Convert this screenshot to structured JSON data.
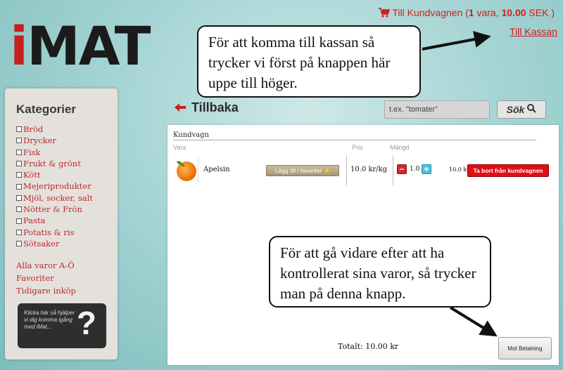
{
  "logo": {
    "i": "i",
    "mat": "MAT"
  },
  "header": {
    "cart_text_prefix": "Till Kundvagnen (",
    "cart_count": "1",
    "cart_mid": " vara, ",
    "cart_amount": "10.00",
    "cart_suffix": " SEK )",
    "checkout_link": "Till Kassan"
  },
  "callouts": {
    "top": "För att komma till kassan så trycker vi först på knappen här uppe till höger.",
    "bottom": "För att gå vidare efter att ha kontrollerat sina varor, så trycker man på denna knapp."
  },
  "sidebar": {
    "title": "Kategorier",
    "categories": [
      "Bröd",
      "Drycker",
      "Fisk",
      "Frukt & grönt",
      "Kött",
      "Mejeriprodukter",
      "Mjöl, socker, salt",
      "Nötter & Frön",
      "Pasta",
      "Potatis & ris",
      "Sötsaker"
    ],
    "links": [
      "Alla varor A-Ö",
      "Favoriter",
      "Tidigare inköp"
    ],
    "help_text": "Klicka här så hjälper vi dig komma igång med iMat...",
    "help_symbol": "?"
  },
  "toolbar": {
    "back_label": "Tillbaka",
    "search_placeholder": "t.ex. \"tomater\"",
    "search_button": "Sök"
  },
  "cart": {
    "title": "Kundvagn",
    "columns": {
      "item": "Vara",
      "price": "Pris",
      "quantity": "Mängd"
    },
    "items": [
      {
        "name": "Apelsin",
        "favorite_button": "Lägg till i favoriter",
        "price": "10.0 kr/kg",
        "quantity": "1.0",
        "total": "10.0 kr",
        "remove_button": "Ta bort från kundvagnen"
      }
    ],
    "total": "Totalt: 10.00 kr",
    "pay_button": "Mot Betalning"
  },
  "colors": {
    "accent_red": "#c71f1f",
    "remove_red": "#e10f15",
    "plus_blue": "#4fc1e0"
  }
}
